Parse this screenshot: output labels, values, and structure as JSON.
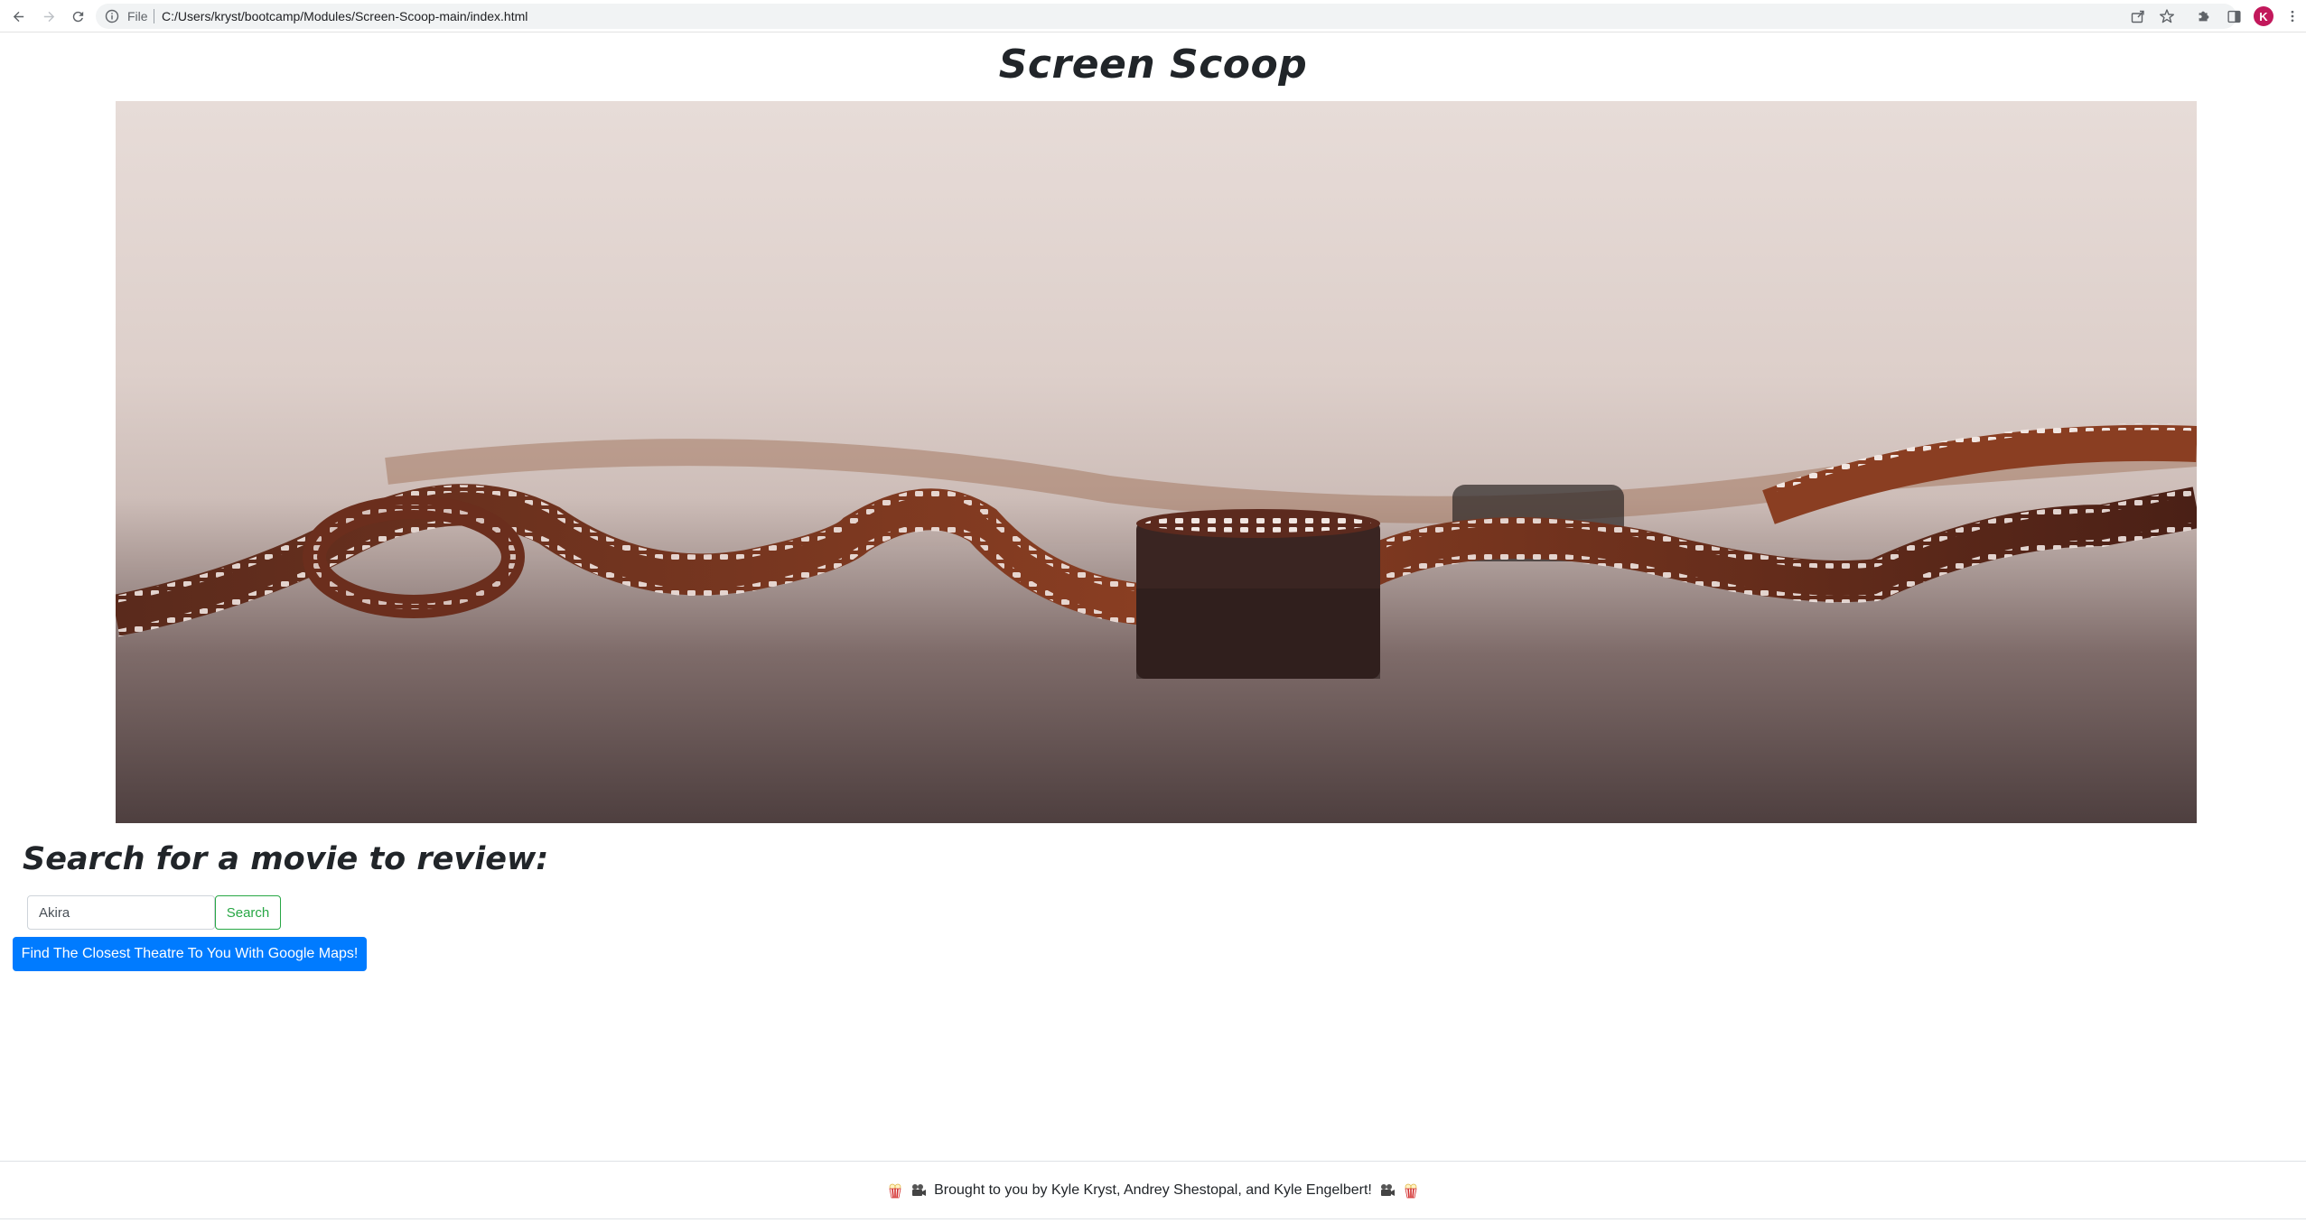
{
  "browser": {
    "scheme_label": "File",
    "url": "C:/Users/kryst/bootcamp/Modules/Screen-Scoop-main/index.html",
    "profile_initial": "K",
    "profile_color": "#c2185b"
  },
  "page": {
    "title": "Screen Scoop",
    "hero_image": "film-reel-photo",
    "search_heading": "Search for a movie to review:",
    "search_input_value": "Akira",
    "search_button": "Search",
    "maps_button": "Find The Closest Theatre To You With Google Maps!"
  },
  "footer": {
    "text": "Brought to you by Kyle Kryst, Andrey Shestopal, and Kyle Engelbert!",
    "icons": [
      "popcorn-icon",
      "movie-camera-icon",
      "movie-camera-icon",
      "popcorn-icon"
    ]
  },
  "colors": {
    "primary": "#007bff",
    "success": "#28a745",
    "text": "#212529"
  }
}
